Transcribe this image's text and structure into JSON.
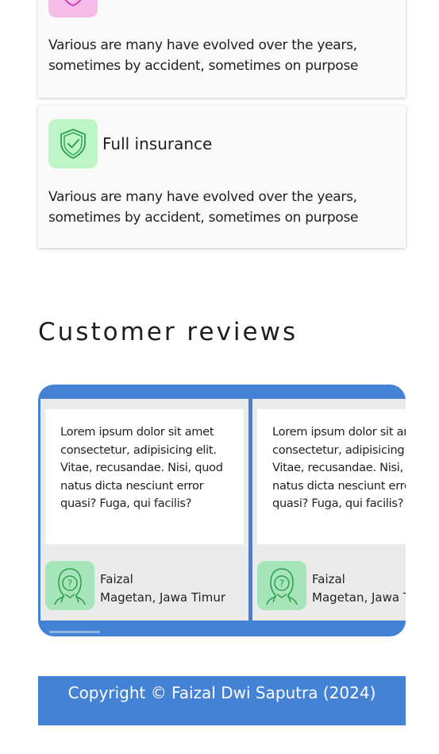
{
  "features": [
    {
      "title": "",
      "description": "Various are many have evolved over the years, sometimes by accident, sometimes on purpose",
      "icon": "shield-icon",
      "icon_bg": "#f6bde8",
      "icon_color": "#cf3fb8"
    },
    {
      "title": "Full insurance",
      "description": "Various are many have evolved over the years, sometimes by accident, sometimes on purpose",
      "icon": "shield-check-icon",
      "icon_bg": "#bdf5c6",
      "icon_color": "#2f9e4f"
    }
  ],
  "reviews_section": {
    "title": "Customer reviews",
    "carousel_bg": "#4382d4",
    "items": [
      {
        "text": "Lorem ipsum dolor sit amet consectetur, adipisicing elit. Vitae, recusandae. Nisi, quod natus dicta nesciunt error quasi? Fuga, qui facilis?",
        "name": "Faizal",
        "location": "Magetan, Jawa Timur",
        "avatar_icon": "hijab-person-question-icon"
      },
      {
        "text": "Lorem ipsum dolor sit amet consectetur, adipisicing elit. Vitae, recusandae. Nisi, quod natus dicta nesciunt error quasi? Fuga, qui facilis?",
        "name": "Faizal",
        "location": "Magetan, Jawa Timur",
        "avatar_icon": "hijab-person-question-icon"
      }
    ]
  },
  "footer": {
    "copyright": "Copyright © Faizal Dwi Saputra (2024)",
    "bg": "#4382d4"
  }
}
